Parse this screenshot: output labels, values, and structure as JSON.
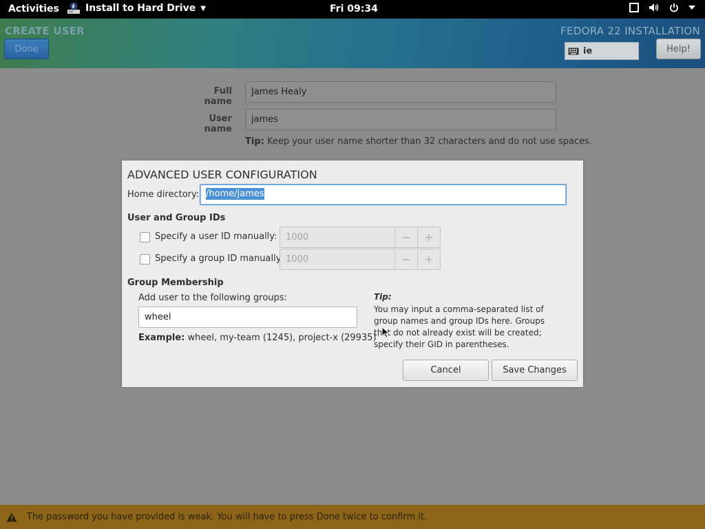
{
  "topbar": {
    "activities": "Activities",
    "app_name": "Install to Hard Drive",
    "clock": "Fri 09:34",
    "icons": [
      "fedora-installer-icon",
      "window-icon",
      "volume-icon",
      "power-icon",
      "chevron-down-icon"
    ]
  },
  "header": {
    "spoke_title": "CREATE USER",
    "done_label": "Done",
    "install_title": "FEDORA 22 INSTALLATION",
    "keyboard_layout": "ie",
    "help_label": "Help!"
  },
  "form": {
    "full_name_label": "Full name",
    "full_name_value": "James Healy",
    "user_name_label": "User name",
    "user_name_value": "james",
    "tip_label": "Tip:",
    "tip_text": "Keep your user name shorter than 32 characters and do not use spaces."
  },
  "dialog": {
    "title": "ADVANCED USER CONFIGURATION",
    "home_dir_label": "Home directory:",
    "home_dir_value": "/home/james",
    "ids_section": "User and Group IDs",
    "uid_label": "Specify a user ID manually:",
    "uid_value": "1000",
    "gid_label": "Specify a group ID manually:",
    "gid_value": "1000",
    "group_section": "Group Membership",
    "groups_label": "Add user to the following groups:",
    "groups_value": "wheel",
    "example_label": "Example:",
    "example_text": "wheel, my-team (1245), project-x (29935)",
    "tip_head": "Tip:",
    "tip_body": "You may input a comma-separated list of group names and group IDs here. Groups that do not already exist will be created; specify their GID in parentheses.",
    "cancel_label": "Cancel",
    "save_label": "Save Changes",
    "minus": "−",
    "plus": "+"
  },
  "warning": {
    "text": "The password you have provided is weak. You will have to press Done twice to confirm it."
  }
}
